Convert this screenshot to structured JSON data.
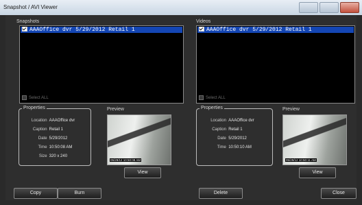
{
  "window": {
    "title": "Snapshot / AVI Viewer"
  },
  "snapshots": {
    "label": "Snapshots",
    "items": [
      {
        "text": "AAAOffice dvr 5/29/2012 Retail 1",
        "checked": true
      }
    ],
    "select_all": "Select ALL",
    "properties": {
      "legend": "Properties",
      "rows": [
        {
          "key": "Location",
          "value": "AAAOffice dvr"
        },
        {
          "key": "Caption",
          "value": "Retail 1"
        },
        {
          "key": "Date",
          "value": "5/29/2012"
        },
        {
          "key": "Time",
          "value": "10:50:08 AM"
        },
        {
          "key": "Size",
          "value": "320 x 240"
        }
      ]
    },
    "preview_label": "Preview",
    "preview_stamp": "05/29/12 10:50:08 AM",
    "view_button": "View"
  },
  "videos": {
    "label": "Videos",
    "items": [
      {
        "text": "AAAOffice dvr 5/29/2012 Retail 1",
        "checked": true
      }
    ],
    "select_all": "Select ALL",
    "properties": {
      "legend": "Properties",
      "rows": [
        {
          "key": "Location",
          "value": "AAAOffice dvr"
        },
        {
          "key": "Caption",
          "value": "Retail 1"
        },
        {
          "key": "Date",
          "value": "5/29/2012"
        },
        {
          "key": "Time",
          "value": "10:50:10 AM"
        }
      ]
    },
    "preview_label": "Preview",
    "preview_stamp": "05/29/12 10:50:11 AM",
    "view_button": "View"
  },
  "footer": {
    "copy": "Copy",
    "burn": "Burn",
    "delete": "Delete",
    "close": "Close"
  },
  "colors": {
    "selection": "#1446b4",
    "background": "#2e2e2e"
  }
}
